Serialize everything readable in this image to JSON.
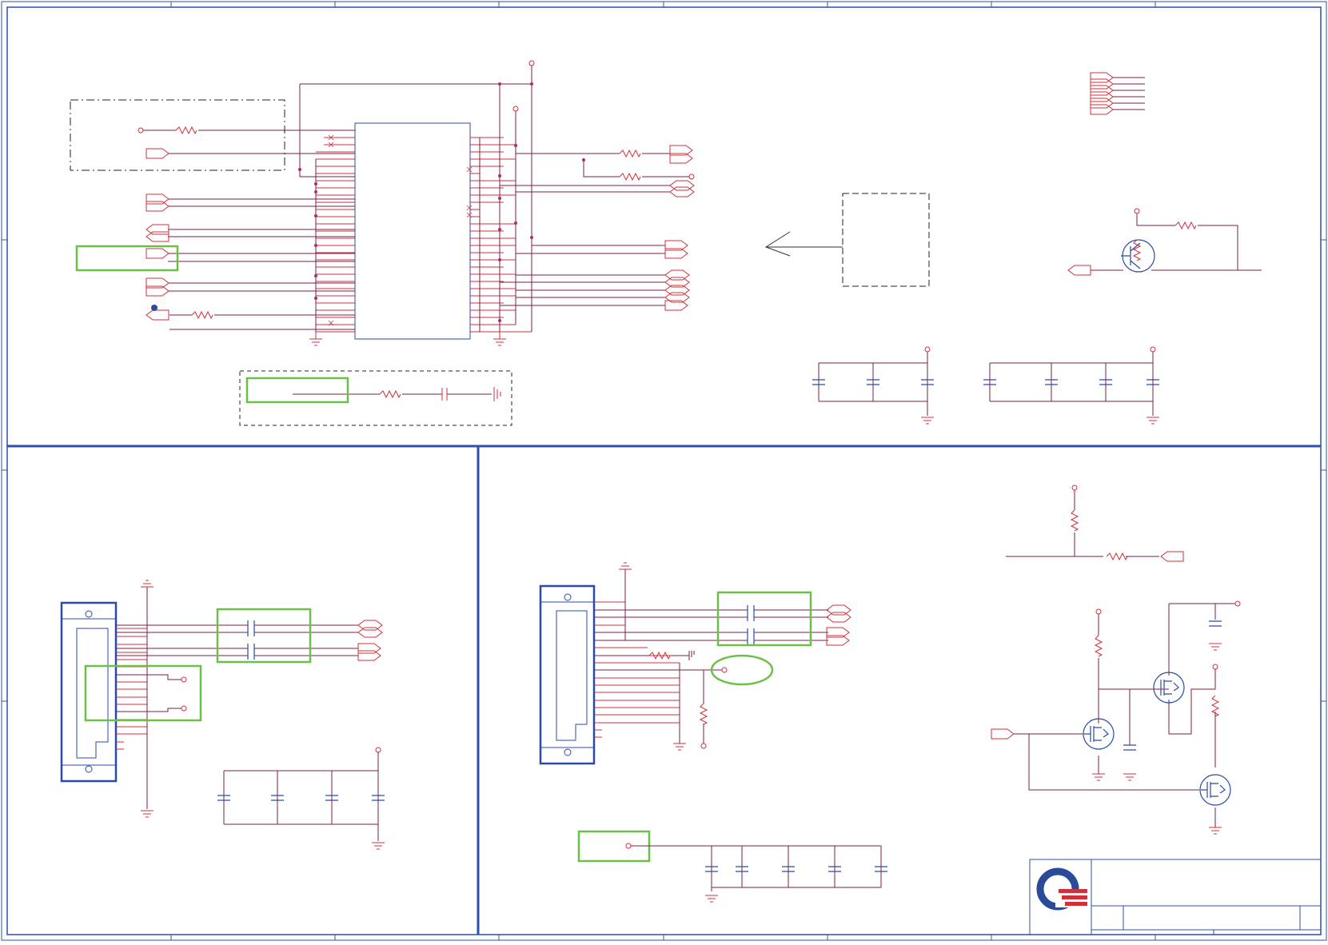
{
  "colors": {
    "wire": "#d0303a",
    "net": "#7a1f4a",
    "part": "#2a4aa8",
    "frame": "#2f4fa8",
    "highlight": "#6cc04a",
    "dash": "#222222",
    "logo_blue": "#2a4a9a",
    "logo_red": "#d0303a"
  },
  "title_block": {
    "logo": "company-logo"
  }
}
